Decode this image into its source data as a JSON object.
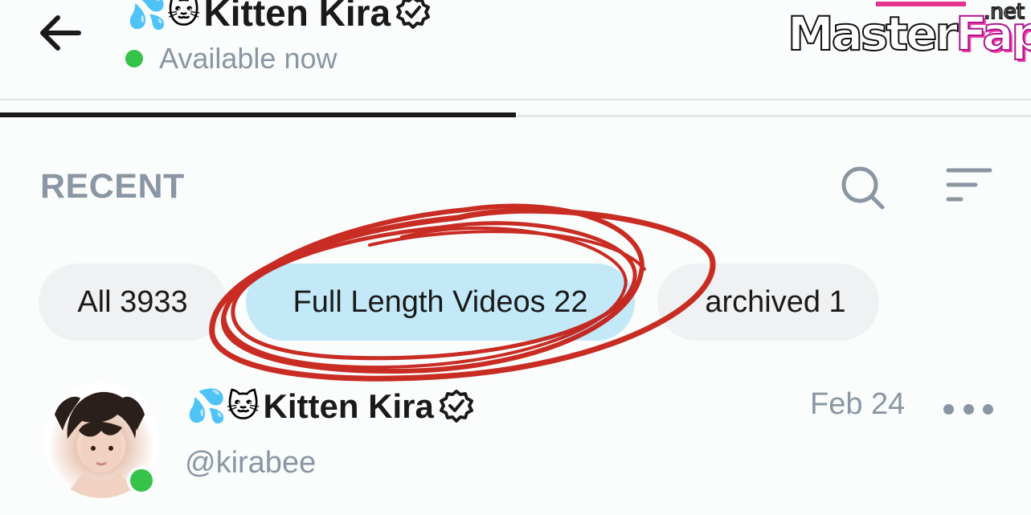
{
  "header": {
    "emojis": "💦🐱",
    "title": "Kitten Kira",
    "status": "Available now",
    "status_color": "#35c34a"
  },
  "watermark": {
    "main_a": "Master",
    "main_b": "Fap",
    "suffix": ".net"
  },
  "section": {
    "title": "RECENT",
    "search_icon": "search-icon",
    "sort_icon": "sort-icon"
  },
  "filters": [
    {
      "label": "All 3933",
      "active": false
    },
    {
      "label": "Full Length Videos 22",
      "active": true
    },
    {
      "label": "Archived 1",
      "visible_text": "archived 1",
      "active": false
    }
  ],
  "post": {
    "emojis": "💦🐱",
    "name": "Kitten Kira",
    "handle": "@kirabee",
    "date": "Feb 24"
  },
  "colors": {
    "muted_text": "#8a96a3",
    "active_chip": "#c3e9f8",
    "chip": "#eff1f3",
    "annotation": "#c4160c"
  }
}
